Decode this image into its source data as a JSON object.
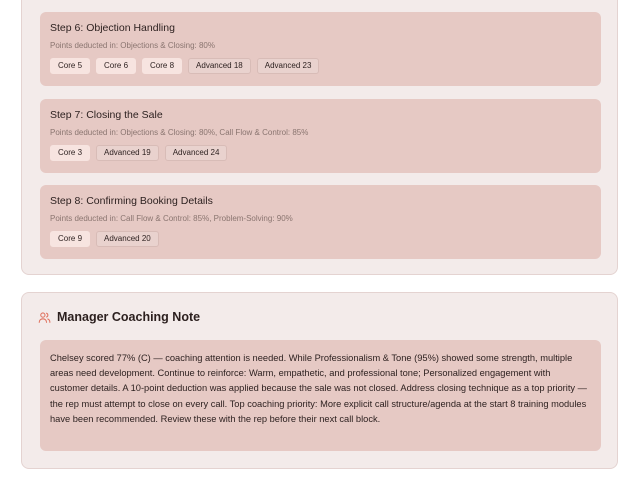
{
  "steps": [
    {
      "title": "Step 6: Objection Handling",
      "sub": "Points deducted in: Objections & Closing: 80%",
      "tags": [
        {
          "label": "Core 5",
          "kind": "core"
        },
        {
          "label": "Core 6",
          "kind": "core"
        },
        {
          "label": "Core 8",
          "kind": "core"
        },
        {
          "label": "Advanced 18",
          "kind": "adv"
        },
        {
          "label": "Advanced 23",
          "kind": "adv"
        }
      ]
    },
    {
      "title": "Step 7: Closing the Sale",
      "sub": "Points deducted in: Objections & Closing: 80%, Call Flow & Control: 85%",
      "tags": [
        {
          "label": "Core 3",
          "kind": "core"
        },
        {
          "label": "Advanced 19",
          "kind": "adv"
        },
        {
          "label": "Advanced 24",
          "kind": "adv"
        }
      ]
    },
    {
      "title": "Step 8: Confirming Booking Details",
      "sub": "Points deducted in: Call Flow & Control: 85%, Problem-Solving: 90%",
      "tags": [
        {
          "label": "Core 9",
          "kind": "core"
        },
        {
          "label": "Advanced 20",
          "kind": "adv"
        }
      ]
    }
  ],
  "coaching": {
    "icon": "users-icon",
    "title": "Manager Coaching Note",
    "body": "Chelsey scored 77% (C) — coaching attention is needed. While Professionalism & Tone (95%) showed some strength, multiple areas need development. Continue to reinforce: Warm, empathetic, and professional tone; Personalized engagement with customer details. A 10-point deduction was applied because the sale was not closed. Address closing technique as a top priority — the rep must attempt to close on every call. Top coaching priority: More explicit call structure/agenda at the start 8 training modules have been recommended. Review these with the rep before their next call block."
  },
  "colors": {
    "card_bg": "#f3ebea",
    "step_bg": "#e6c9c4",
    "core_tag_bg": "#f7e4e0",
    "icon_accent": "#e0725f"
  }
}
